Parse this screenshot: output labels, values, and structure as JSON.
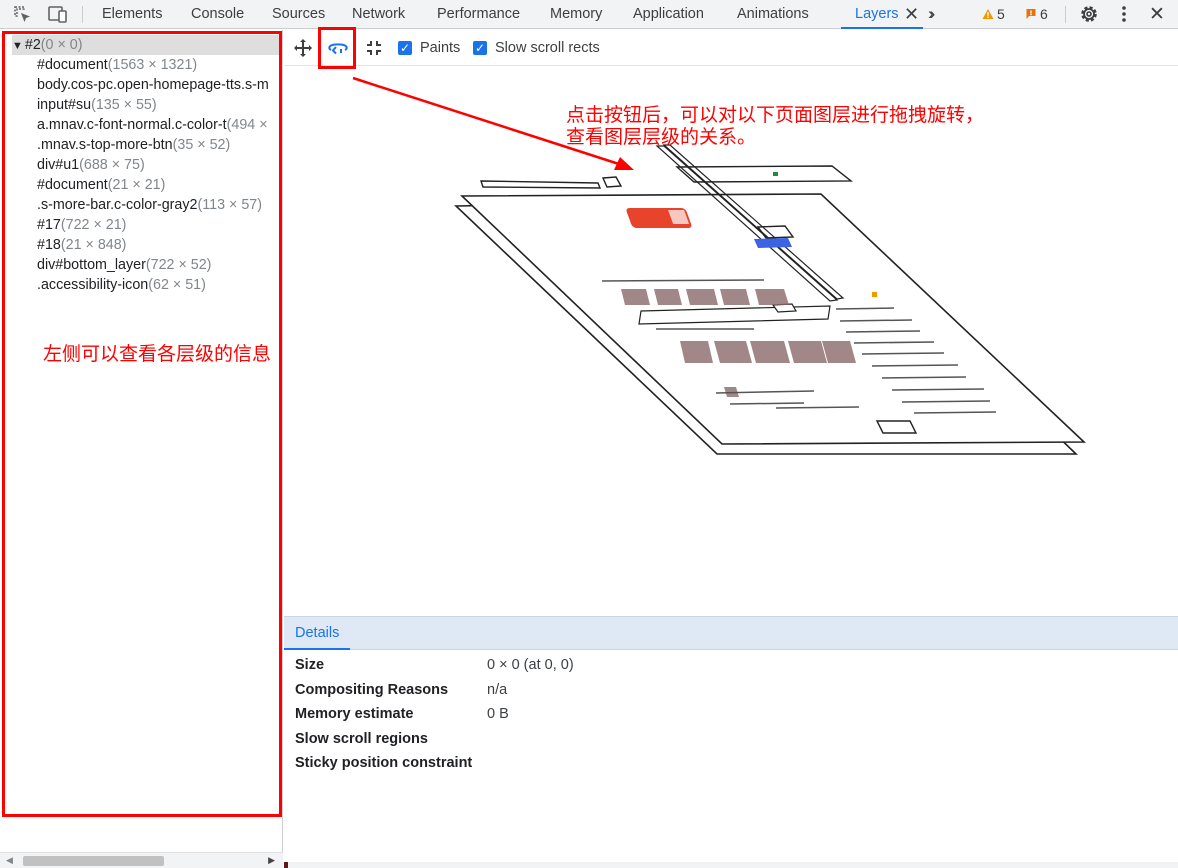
{
  "top_tabs": [
    {
      "label": "Elements",
      "active": false
    },
    {
      "label": "Console",
      "active": false
    },
    {
      "label": "Sources",
      "active": false
    },
    {
      "label": "Network",
      "active": false
    },
    {
      "label": "Performance",
      "active": false
    },
    {
      "label": "Memory",
      "active": false
    },
    {
      "label": "Application",
      "active": false
    },
    {
      "label": "Animations",
      "active": false
    },
    {
      "label": "Layers",
      "active": true
    }
  ],
  "top_icons": [
    "inspect-element-icon",
    "device-toolbar-icon",
    "close-tab-icon",
    "more-tabs-icon",
    "settings-gear-icon",
    "kebab-menu-icon",
    "close-devtools-icon"
  ],
  "badges": {
    "warnings": "5",
    "issues": "6",
    "warning_color": "#f29900",
    "issue_color": "#e8710a"
  },
  "layer_tree": {
    "root": {
      "name": "#2",
      "size": "(0 × 0)"
    },
    "children": [
      {
        "name": "#document",
        "size": "(1563 × 1321)"
      },
      {
        "name": "body.cos-pc.open-homepage-tts.s-m",
        "size": ""
      },
      {
        "name": "input#su",
        "size": "(135 × 55)"
      },
      {
        "name": "a.mnav.c-font-normal.c-color-t",
        "size": "(494 ×"
      },
      {
        "name": ".mnav.s-top-more-btn",
        "size": "(35 × 52)"
      },
      {
        "name": "div#u1",
        "size": "(688 × 75)"
      },
      {
        "name": "#document",
        "size": "(21 × 21)"
      },
      {
        "name": ".s-more-bar.c-color-gray2",
        "size": "(113 × 57)"
      },
      {
        "name": "#17",
        "size": "(722 × 21)"
      },
      {
        "name": "#18",
        "size": "(21 × 848)"
      },
      {
        "name": "div#bottom_layer",
        "size": "(722 × 52)"
      },
      {
        "name": ".accessibility-icon",
        "size": "(62 × 51)"
      }
    ]
  },
  "toolbar": {
    "tools": [
      "pan-mode-icon",
      "rotate-mode-icon",
      "reset-transform-icon"
    ],
    "paints_label": "Paints",
    "paints_checked": true,
    "slow_scroll_label": "Slow scroll rects",
    "slow_scroll_checked": true
  },
  "details": {
    "tab_label": "Details",
    "rows": [
      {
        "key": "Size",
        "value": "0 × 0 (at 0, 0)"
      },
      {
        "key": "Compositing Reasons",
        "value": "n/a"
      },
      {
        "key": "Memory estimate",
        "value": "0 B"
      },
      {
        "key": "Slow scroll regions",
        "value": ""
      },
      {
        "key": "Sticky position constraint",
        "value": ""
      }
    ]
  },
  "annotations": {
    "right_line1": "点击按钮后，可以对以下页面图层进行拖拽旋转，",
    "right_line2": "查看图层层级的关系。",
    "left": "左侧可以查看各层级的信息",
    "color": "#ff0000"
  },
  "accent": "#1a73e8"
}
